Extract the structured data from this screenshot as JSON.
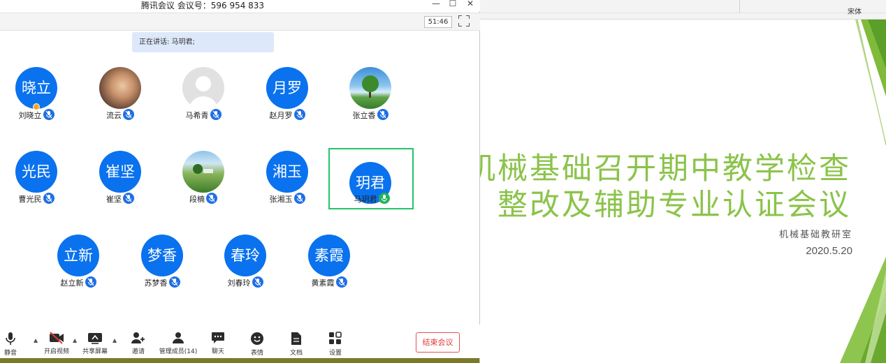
{
  "window": {
    "title": "腾讯会议 会议号：596 954 833",
    "timer": "51:46",
    "speaking": "正在讲话: 马玥君;"
  },
  "participants": [
    {
      "name": "刘晓立",
      "initials": "晓立",
      "avatar": "initials",
      "mic": "muted",
      "host": true
    },
    {
      "name": "流云",
      "initials": "",
      "avatar": "photo-cat",
      "mic": "muted"
    },
    {
      "name": "马希青",
      "initials": "",
      "avatar": "default-person",
      "mic": "muted"
    },
    {
      "name": "赵月罗",
      "initials": "月罗",
      "avatar": "initials",
      "mic": "muted"
    },
    {
      "name": "张立香",
      "initials": "",
      "avatar": "photo-tree",
      "mic": "muted"
    },
    {
      "name": "曹光民",
      "initials": "光民",
      "avatar": "initials",
      "mic": "muted"
    },
    {
      "name": "崔坚",
      "initials": "崔坚",
      "avatar": "initials",
      "mic": "muted"
    },
    {
      "name": "段楠",
      "initials": "",
      "avatar": "photo-landscape",
      "mic": "muted"
    },
    {
      "name": "张湘玉",
      "initials": "湘玉",
      "avatar": "initials",
      "mic": "muted"
    },
    {
      "name": "马玥君",
      "initials": "玥君",
      "avatar": "initials",
      "mic": "speaking",
      "active": true
    },
    {
      "name": "赵立新",
      "initials": "立新",
      "avatar": "initials",
      "mic": "muted"
    },
    {
      "name": "苏梦香",
      "initials": "梦香",
      "avatar": "initials",
      "mic": "muted"
    },
    {
      "name": "刘春玲",
      "initials": "春玲",
      "avatar": "initials",
      "mic": "muted"
    },
    {
      "name": "黄素霞",
      "initials": "素霞",
      "avatar": "initials",
      "mic": "muted"
    }
  ],
  "toolbar": {
    "mute": "静音",
    "video": "开启视频",
    "share": "共享屏幕",
    "invite": "邀请",
    "manage": "管理成员(14)",
    "chat": "聊天",
    "emoji": "表情",
    "docs": "文档",
    "settings": "设置",
    "end": "结束会议"
  },
  "slide": {
    "ribbon_font": "宋体",
    "title_line1": "机械基础召开期中教学检查",
    "title_line2": "整改及辅助专业认证会议",
    "department": "机械基础教研室",
    "date": "2020.5.20"
  },
  "colors": {
    "avatar_blue": "#0a72ee",
    "slide_green": "#8bc34a",
    "speaking_border": "#24c46b",
    "end_red": "#e03c3c"
  }
}
